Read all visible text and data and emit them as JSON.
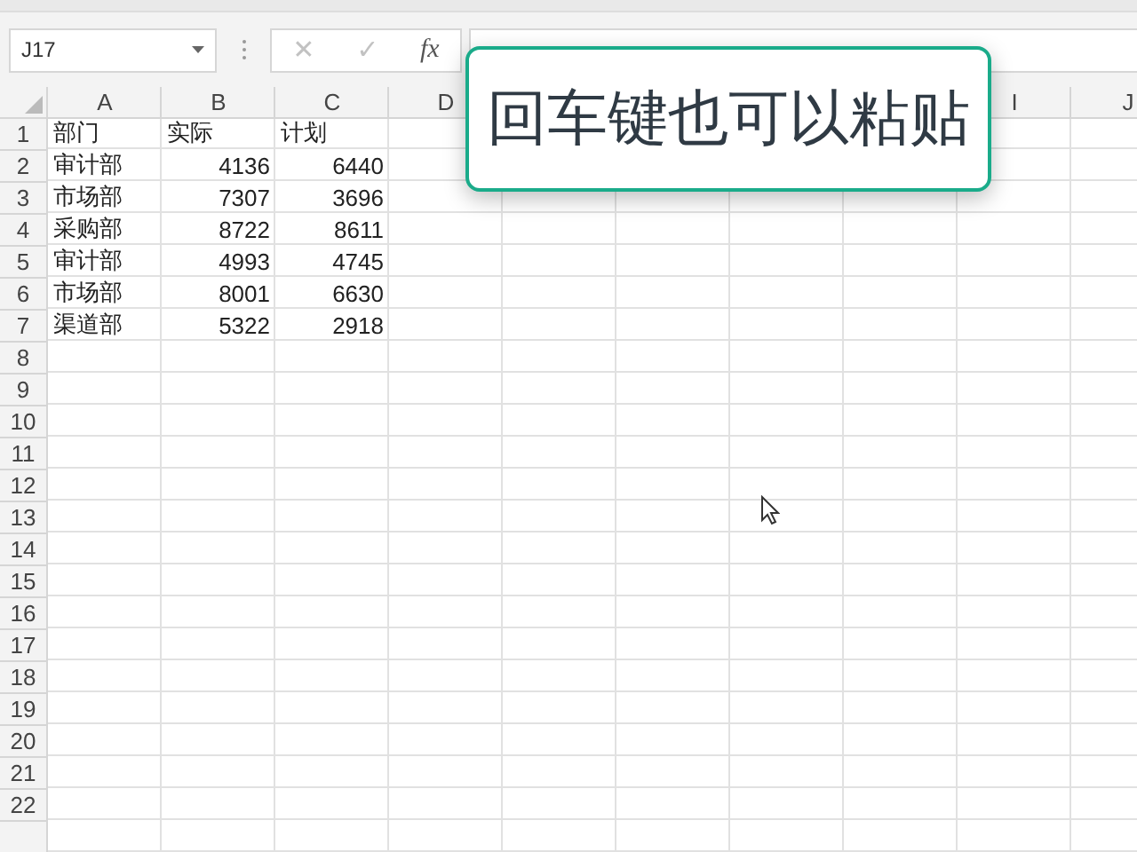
{
  "name_box": {
    "value": "J17"
  },
  "formula_bar": {
    "cancel": "✕",
    "enter": "✓",
    "function": "fx"
  },
  "columns": [
    "A",
    "B",
    "C",
    "D",
    "I",
    "J"
  ],
  "rows": [
    {
      "number": "1",
      "kind": "header",
      "cells": [
        "部门",
        "实际",
        "计划"
      ]
    },
    {
      "number": "2",
      "kind": "data",
      "cells": [
        "审计部",
        "4136",
        "6440"
      ]
    },
    {
      "number": "3",
      "kind": "data",
      "cells": [
        "市场部",
        "7307",
        "3696"
      ]
    },
    {
      "number": "4",
      "kind": "data",
      "cells": [
        "采购部",
        "8722",
        "8611"
      ]
    },
    {
      "number": "5",
      "kind": "data",
      "cells": [
        "审计部",
        "4993",
        "4745"
      ]
    },
    {
      "number": "6",
      "kind": "data",
      "cells": [
        "市场部",
        "8001",
        "6630"
      ]
    },
    {
      "number": "7",
      "kind": "data",
      "cells": [
        "渠道部",
        "5322",
        "2918"
      ]
    },
    {
      "number": "8",
      "cells": []
    },
    {
      "number": "9",
      "cells": []
    },
    {
      "number": "10",
      "cells": []
    },
    {
      "number": "11",
      "cells": []
    },
    {
      "number": "12",
      "cells": []
    },
    {
      "number": "13",
      "cells": []
    },
    {
      "number": "14",
      "cells": []
    },
    {
      "number": "15",
      "cells": []
    },
    {
      "number": "16",
      "cells": []
    },
    {
      "number": "17",
      "cells": []
    },
    {
      "number": "18",
      "cells": []
    },
    {
      "number": "19",
      "cells": []
    },
    {
      "number": "20",
      "cells": []
    },
    {
      "number": "21",
      "cells": []
    },
    {
      "number": "22",
      "cells": []
    }
  ],
  "toast": {
    "text": "回车键也可以粘贴"
  }
}
